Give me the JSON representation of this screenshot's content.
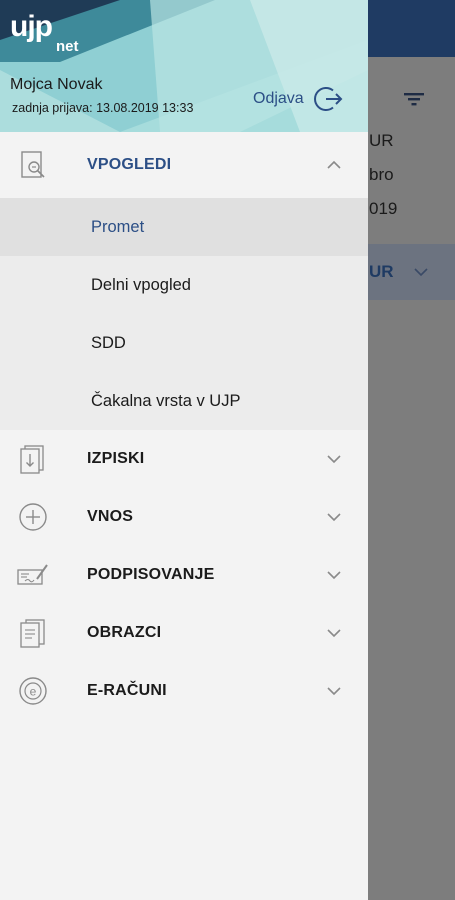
{
  "background": {
    "lines": [
      "UR",
      "bro",
      "019"
    ],
    "row_label": "UR"
  },
  "header": {
    "logo_main": "ujp",
    "logo_sub": "net",
    "user_name": "Mojca Novak",
    "last_login": "zadnja prijava: 13.08.2019 13:33",
    "logout_label": "Odjava"
  },
  "menu": [
    {
      "label": "VPOGLEDI",
      "icon": "search-document-icon",
      "expanded": true,
      "children": [
        {
          "label": "Promet",
          "active": true
        },
        {
          "label": "Delni vpogled"
        },
        {
          "label": "SDD"
        },
        {
          "label": "Čakalna vrsta v UJP"
        }
      ]
    },
    {
      "label": "IZPISKI",
      "icon": "statement-download-icon",
      "expanded": false
    },
    {
      "label": "VNOS",
      "icon": "plus-circle-icon",
      "expanded": false
    },
    {
      "label": "PODPISOVANJE",
      "icon": "signature-icon",
      "expanded": false
    },
    {
      "label": "OBRAZCI",
      "icon": "forms-icon",
      "expanded": false
    },
    {
      "label": "E-RAČUNI",
      "icon": "e-invoice-icon",
      "expanded": false
    }
  ],
  "colors": {
    "accent": "#2c4f86",
    "topbar": "#1f3b63",
    "drawer_bg": "#f3f3f3",
    "active_bg": "#e0e0e0"
  }
}
